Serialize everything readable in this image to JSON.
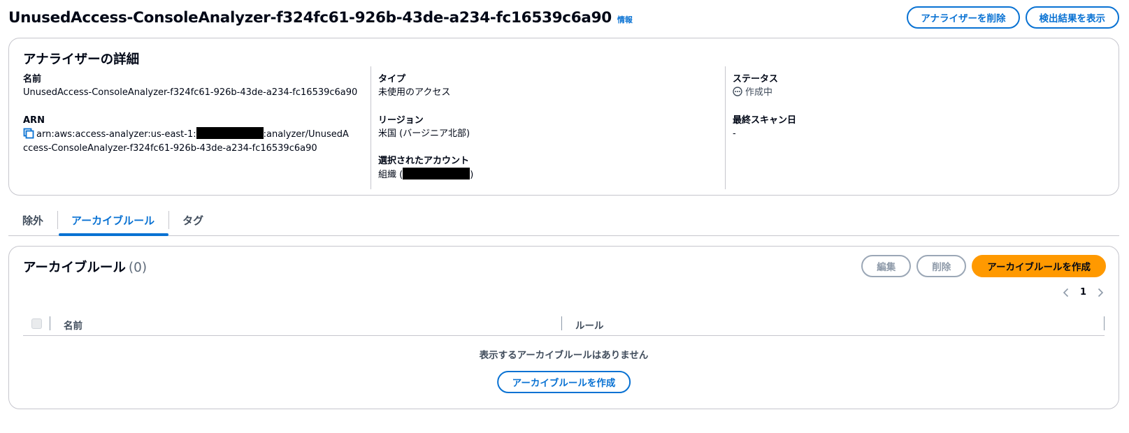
{
  "header": {
    "title": "UnusedAccess-ConsoleAnalyzer-f324fc61-926b-43de-a234-fc16539c6a90",
    "info_link": "情報",
    "delete_button": "アナライザーを削除",
    "view_findings_button": "検出結果を表示"
  },
  "details": {
    "title": "アナライザーの詳細",
    "name_label": "名前",
    "name_value": "UnusedAccess-ConsoleAnalyzer-f324fc61-926b-43de-a234-fc16539c6a90",
    "arn_label": "ARN",
    "arn_prefix": "arn:aws:access-analyzer:us-east-1:",
    "arn_suffix": ":analyzer/UnusedAccess-ConsoleAnalyzer-f324fc61-926b-43de-a234-fc16539c6a90",
    "type_label": "タイプ",
    "type_value": "未使用のアクセス",
    "region_label": "リージョン",
    "region_value": "米国 (バージニア北部)",
    "accounts_label": "選択されたアカウント",
    "accounts_prefix": "組織 (",
    "accounts_suffix": ")",
    "status_label": "ステータス",
    "status_value": "作成中",
    "last_scan_label": "最終スキャン日",
    "last_scan_value": "-"
  },
  "tabs": [
    {
      "label": "除外",
      "active": false
    },
    {
      "label": "アーカイブルール",
      "active": true
    },
    {
      "label": "タグ",
      "active": false
    }
  ],
  "rules": {
    "title": "アーカイブルール",
    "count": "(0)",
    "edit_button": "編集",
    "delete_button": "削除",
    "create_button": "アーカイブルールを作成",
    "page_number": "1",
    "columns": [
      "名前",
      "ルール"
    ],
    "empty_message": "表示するアーカイブルールはありません",
    "empty_create_button": "アーカイブルールを作成"
  },
  "colors": {
    "link_blue": "#0972d3",
    "primary_orange": "#ff9900",
    "border_gray": "#c6c6cd",
    "text_dark": "#000716"
  },
  "icons": {
    "copy": "copy-icon",
    "status": "in-progress-icon",
    "pager_prev": "chevron-left-icon",
    "pager_next": "chevron-right-icon"
  }
}
